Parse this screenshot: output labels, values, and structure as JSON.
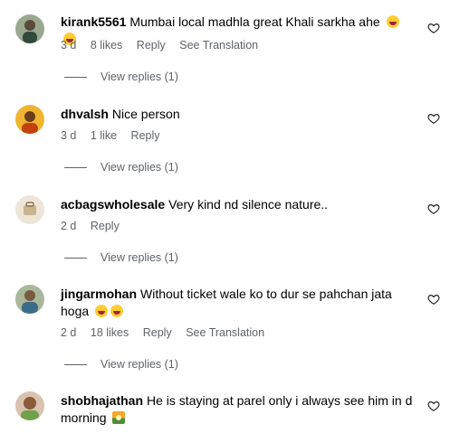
{
  "comments": [
    {
      "username": "kirank5561",
      "text": "Mumbai local madhla great Khali sarkha ahe",
      "emojis": [
        "laughing-emoji",
        "laughing-emoji"
      ],
      "time": "3 d",
      "likes": "8 likes",
      "reply_label": "Reply",
      "translate_label": "See Translation",
      "view_replies": "View replies (1)",
      "avatar_color": "#7a8a6a"
    },
    {
      "username": "dhvalsh",
      "text": "Nice person",
      "emojis": [],
      "time": "3 d",
      "likes": "1 like",
      "reply_label": "Reply",
      "view_replies": "View replies (1)",
      "avatar_color": "#e0a020"
    },
    {
      "username": "acbagswholesale",
      "text": "Very kind nd silence nature..",
      "emojis": [],
      "time": "2 d",
      "reply_label": "Reply",
      "view_replies": "View replies (1)",
      "avatar_color": "#d9c9a8"
    },
    {
      "username": "jingarmohan",
      "text": "Without ticket wale ko to dur se pahchan jata hoga",
      "emojis": [
        "laughing-emoji",
        "laughing-emoji"
      ],
      "time": "2 d",
      "likes": "18 likes",
      "reply_label": "Reply",
      "translate_label": "See Translation",
      "view_replies": "View replies (1)",
      "avatar_color": "#8a9a7a"
    },
    {
      "username": "shobhajathan",
      "text": "He is staying at parel only i always see him in d morning",
      "emojis": [
        "sunrise-emoji"
      ],
      "avatar_color": "#c08a6a"
    }
  ]
}
